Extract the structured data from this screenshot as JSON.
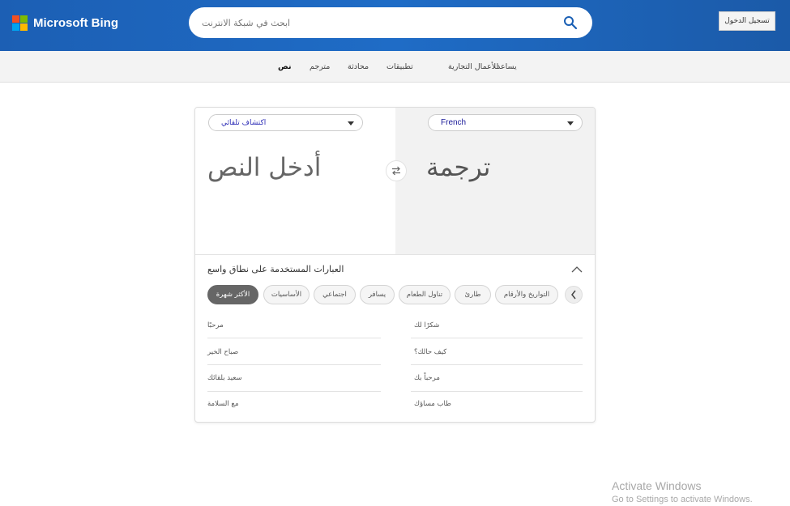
{
  "header": {
    "logo_text": "Microsoft Bing",
    "search_placeholder": "ابحث في شبكة الانترنت",
    "signin_label": "تسجيل الدخول",
    "logo_colors": [
      "#f25022",
      "#7fba00",
      "#00a4ef",
      "#ffb900"
    ]
  },
  "nav": {
    "items": [
      "يساعد",
      "للأعمال التجارية",
      "تطبيقات",
      "محادثة",
      "مترجم",
      "نص"
    ],
    "active": "نص"
  },
  "translator": {
    "source_language": "اكتشاف تلقائي",
    "target_language": "French",
    "source_placeholder": "أدخل النص",
    "target_placeholder": "ترجمة",
    "swap_icon": "swap-icon"
  },
  "phrases": {
    "title": "العبارات المستخدمة على نطاق واسع",
    "categories": [
      "التواريخ والأرقام",
      "طارئ",
      "تناول الطعام",
      "يسافر",
      "اجتماعي",
      "الأساسيات",
      "الأكثر شهرة"
    ],
    "active_category": "الأكثر شهرة",
    "left_column": [
      "مرحبًا",
      "صباح الخير",
      "سعيد بلقائك",
      "مع السلامة"
    ],
    "right_column": [
      "شكرًا لك",
      "كيف حالك؟",
      "مرحباً بك",
      "طاب مساؤك"
    ]
  },
  "watermark": {
    "line1": "Activate Windows",
    "line2": "Go to Settings to activate Windows."
  }
}
